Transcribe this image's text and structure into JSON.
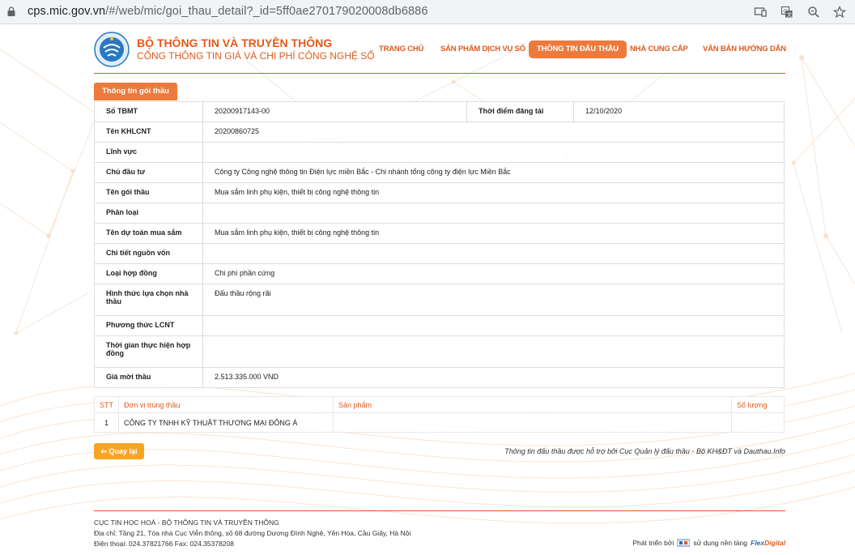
{
  "browser": {
    "url_host": "cps.mic.gov.vn",
    "url_path": "/#/web/mic/goi_thau_detail?_id=5ff0ae270179020008db6886"
  },
  "header": {
    "title": "BỘ THÔNG TIN VÀ TRUYỀN THÔNG",
    "subtitle": "CỔNG THÔNG TIN GIÁ VÀ CHI PHÍ CÔNG NGHỆ SỐ",
    "nav": [
      "TRANG CHỦ",
      "SẢN PHẨM DỊCH VỤ SỐ",
      "THÔNG TIN ĐẤU THẦU",
      "NHÀ CUNG CẤP",
      "VĂN BẢN HƯỚNG DẪN"
    ],
    "active_nav": "THÔNG TIN ĐẤU THẦU",
    "accent_color": "#e05a1c"
  },
  "tab": {
    "label": "Thông tin gói thầu"
  },
  "detail": {
    "so_tbmt_label": "Số TBMT",
    "so_tbmt": "20200917143-00",
    "thoi_diem_label": "Thời điểm đăng tải",
    "thoi_diem": "12/10/2020",
    "rows": [
      {
        "label": "Tên KHLCNT",
        "value": "20200860725"
      },
      {
        "label": "Lĩnh vực",
        "value": ""
      },
      {
        "label": "Chủ đầu tư",
        "value": "Công ty Công nghệ thông tin Điện lực miền Bắc - Chi nhánh tổng công ty điện lực Miền Bắc"
      },
      {
        "label": "Tên gói thầu",
        "value": "Mua sắm linh phụ kiện, thiết bị công nghệ thông tin"
      },
      {
        "label": "Phân loại",
        "value": ""
      },
      {
        "label": "Tên dự toán mua sắm",
        "value": "Mua sắm linh phụ kiện, thiết bị công nghệ thông tin"
      },
      {
        "label": "Chi tiết nguồn vốn",
        "value": ""
      },
      {
        "label": "Loại hợp đồng",
        "value": "Chi phí phần cứng"
      },
      {
        "label": "Hình thức lựa chọn nhà thầu",
        "value": "Đấu thầu rộng rãi"
      },
      {
        "label": "Phương thức LCNT",
        "value": ""
      },
      {
        "label": "Thời gian thực hiện hợp đồng",
        "value": ""
      },
      {
        "label": "Giá mời thầu",
        "value": "2.513.335.000  VND"
      }
    ]
  },
  "results": {
    "headers": [
      "STT",
      "Đơn vị trúng thầu",
      "Sản phẩm",
      "Số lượng"
    ],
    "rows": [
      [
        "1",
        "CÔNG TY TNHH KỸ THUẬT THƯƠNG MẠI ĐÔNG Á",
        "",
        ""
      ]
    ]
  },
  "back_label": "Quay lại",
  "support_text": "Thông tin đấu thầu được hỗ trợ bởi Cục Quản lý đấu thầu - Bộ KH&ĐT và Dauthau.Info",
  "footer": {
    "org": "CỤC TIN HỌC HOÁ - BỘ THÔNG TIN VÀ TRUYỀN THÔNG",
    "address": "Địa chỉ: Tầng 21, Tòa nhà Cục Viễn thông, số 68 đường Dương Đình Nghệ, Yên Hòa, Cầu Giấy, Hà Nội",
    "phone": "Điện thoại: 024.37821766 Fax: 024.35378208",
    "dev_prefix": "Phát triển bởi",
    "dev_middle": "sử dụng nền tảng",
    "dev_brand_a": "Flex",
    "dev_brand_b": "Digital"
  }
}
